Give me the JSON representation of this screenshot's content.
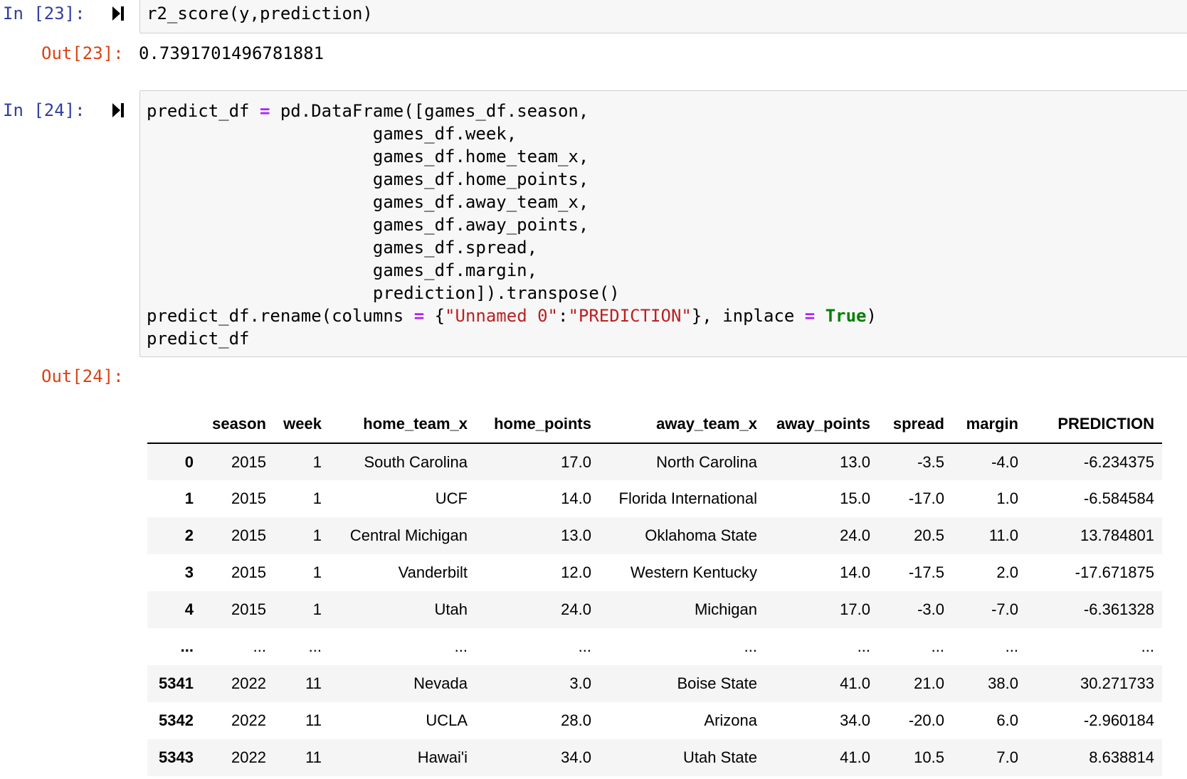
{
  "cells": [
    {
      "in_prompt": "In [23]:",
      "code": "r2_score(y,prediction)",
      "out_prompt": "Out[23]:",
      "output": "0.7391701496781881"
    },
    {
      "in_prompt": "In [24]:",
      "code_lines": {
        "l1_a": "predict_df ",
        "l1_op": "=",
        "l1_b": " pd.DataFrame([games_df.season,",
        "l2": "                      games_df.week,",
        "l3": "                      games_df.home_team_x,",
        "l4": "                      games_df.home_points,",
        "l5": "                      games_df.away_team_x,",
        "l6": "                      games_df.away_points,",
        "l7": "                      games_df.spread,",
        "l8": "                      games_df.margin,",
        "l9": "                      prediction]).transpose()",
        "l10_a": "predict_df.rename(columns ",
        "l10_op1": "=",
        "l10_b": " {",
        "l10_s1": "\"Unnamed 0\"",
        "l10_c": ":",
        "l10_s2": "\"PREDICTION\"",
        "l10_d": "}, inplace ",
        "l10_op2": "=",
        "l10_e": " ",
        "l10_kw": "True",
        "l10_f": ")",
        "l11": "predict_df"
      },
      "out_prompt": "Out[24]:"
    }
  ],
  "table": {
    "columns": [
      "",
      "season",
      "week",
      "home_team_x",
      "home_points",
      "away_team_x",
      "away_points",
      "spread",
      "margin",
      "PREDICTION"
    ],
    "rows": [
      [
        "0",
        "2015",
        "1",
        "South Carolina",
        "17.0",
        "North Carolina",
        "13.0",
        "-3.5",
        "-4.0",
        "-6.234375"
      ],
      [
        "1",
        "2015",
        "1",
        "UCF",
        "14.0",
        "Florida International",
        "15.0",
        "-17.0",
        "1.0",
        "-6.584584"
      ],
      [
        "2",
        "2015",
        "1",
        "Central Michigan",
        "13.0",
        "Oklahoma State",
        "24.0",
        "20.5",
        "11.0",
        "13.784801"
      ],
      [
        "3",
        "2015",
        "1",
        "Vanderbilt",
        "12.0",
        "Western Kentucky",
        "14.0",
        "-17.5",
        "2.0",
        "-17.671875"
      ],
      [
        "4",
        "2015",
        "1",
        "Utah",
        "24.0",
        "Michigan",
        "17.0",
        "-3.0",
        "-7.0",
        "-6.361328"
      ],
      [
        "...",
        "...",
        "...",
        "...",
        "...",
        "...",
        "...",
        "...",
        "...",
        "..."
      ],
      [
        "5341",
        "2022",
        "11",
        "Nevada",
        "3.0",
        "Boise State",
        "41.0",
        "21.0",
        "38.0",
        "30.271733"
      ],
      [
        "5342",
        "2022",
        "11",
        "UCLA",
        "28.0",
        "Arizona",
        "34.0",
        "-20.0",
        "6.0",
        "-2.960184"
      ],
      [
        "5343",
        "2022",
        "11",
        "Hawai'i",
        "34.0",
        "Utah State",
        "41.0",
        "10.5",
        "7.0",
        "8.638814"
      ]
    ]
  },
  "icons": {
    "run_icon": "run-cell-icon"
  }
}
